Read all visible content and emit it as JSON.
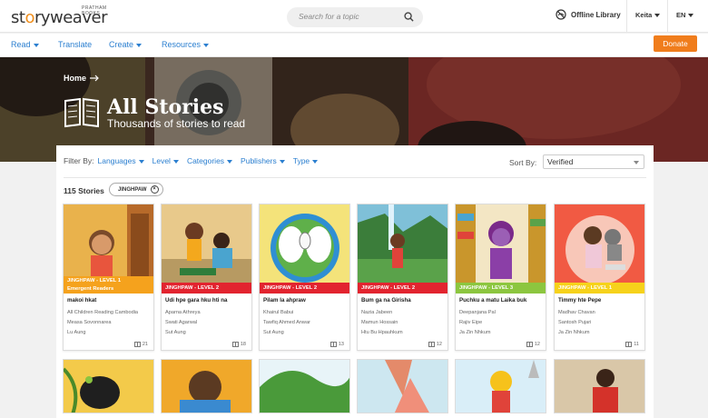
{
  "brand": {
    "wordmark_a": "st",
    "wordmark_b": "ry",
    "wordmark_c": "weaver",
    "publisher_tag": "PRATHAM BOOKS"
  },
  "search": {
    "placeholder": "Search for a topic"
  },
  "header": {
    "offline_label": "Offline Library",
    "user_label": "Keita",
    "language_label": "EN"
  },
  "nav": {
    "read": "Read",
    "translate": "Translate",
    "create": "Create",
    "resources": "Resources",
    "donate": "Donate"
  },
  "banner": {
    "breadcrumb": "Home",
    "title": "All Stories",
    "subtitle": "Thousands of stories to read"
  },
  "filters": {
    "label": "Filter By:",
    "items": [
      "Languages",
      "Level",
      "Categories",
      "Publishers",
      "Type"
    ],
    "sort_label": "Sort By:",
    "sort_value": "Verified"
  },
  "results": {
    "count": "115 Stories",
    "chip": "JINGHPAW"
  },
  "colors": {
    "accent_blue": "#2b7fd0",
    "donate": "#f07d1c",
    "level1": "#f5a21d",
    "level2": "#e2242f",
    "level3": "#8cc63f",
    "level1_alt": "#f6d21b"
  },
  "stories": [
    {
      "level": "JINGHPAW - LEVEL 1",
      "level_sub": "Emergent Readers",
      "title": "makoi hkat",
      "credits": [
        "All Children Reading Cambodia",
        "Measa Sovonnarea",
        "Lu Aung"
      ],
      "reads": "21",
      "level_color": "#f5a21d"
    },
    {
      "level": "JINGHPAW - LEVEL 2",
      "level_sub": "",
      "title": "Udi hpe gara hku hti na",
      "credits": [
        "Aparna Athreya",
        "Swati Agarwal",
        "Sut Aung"
      ],
      "reads": "18",
      "level_color": "#e2242f"
    },
    {
      "level": "JINGHPAW - LEVEL 2",
      "level_sub": "",
      "title": "Pilam la ahpraw",
      "credits": [
        "Khairul Babui",
        "Tawfiq Ahmed Anwar",
        "Sut Aung"
      ],
      "reads": "13",
      "level_color": "#e2242f"
    },
    {
      "level": "JINGHPAW - LEVEL 2",
      "level_sub": "",
      "title": "Bum ga na Girisha",
      "credits": [
        "Nazia Jabeen",
        "Mamun Hossain",
        "Htu Bu Hpauhkum"
      ],
      "reads": "12",
      "level_color": "#e2242f"
    },
    {
      "level": "JINGHPAW - LEVEL 3",
      "level_sub": "",
      "title": "Puchku a matu Laika buk",
      "credits": [
        "Deepanjana Pal",
        "Rajiv Eipe",
        "Ja Zin Nhkum"
      ],
      "reads": "12",
      "level_color": "#8cc63f"
    },
    {
      "level": "JINGHPAW - LEVEL 1",
      "level_sub": "",
      "title": "Timmy hte Pepe",
      "credits": [
        "Madhav Chavan",
        "Santosh Pujari",
        "Ja Zin Nhkum"
      ],
      "reads": "11",
      "level_color": "#f6d21b"
    }
  ]
}
